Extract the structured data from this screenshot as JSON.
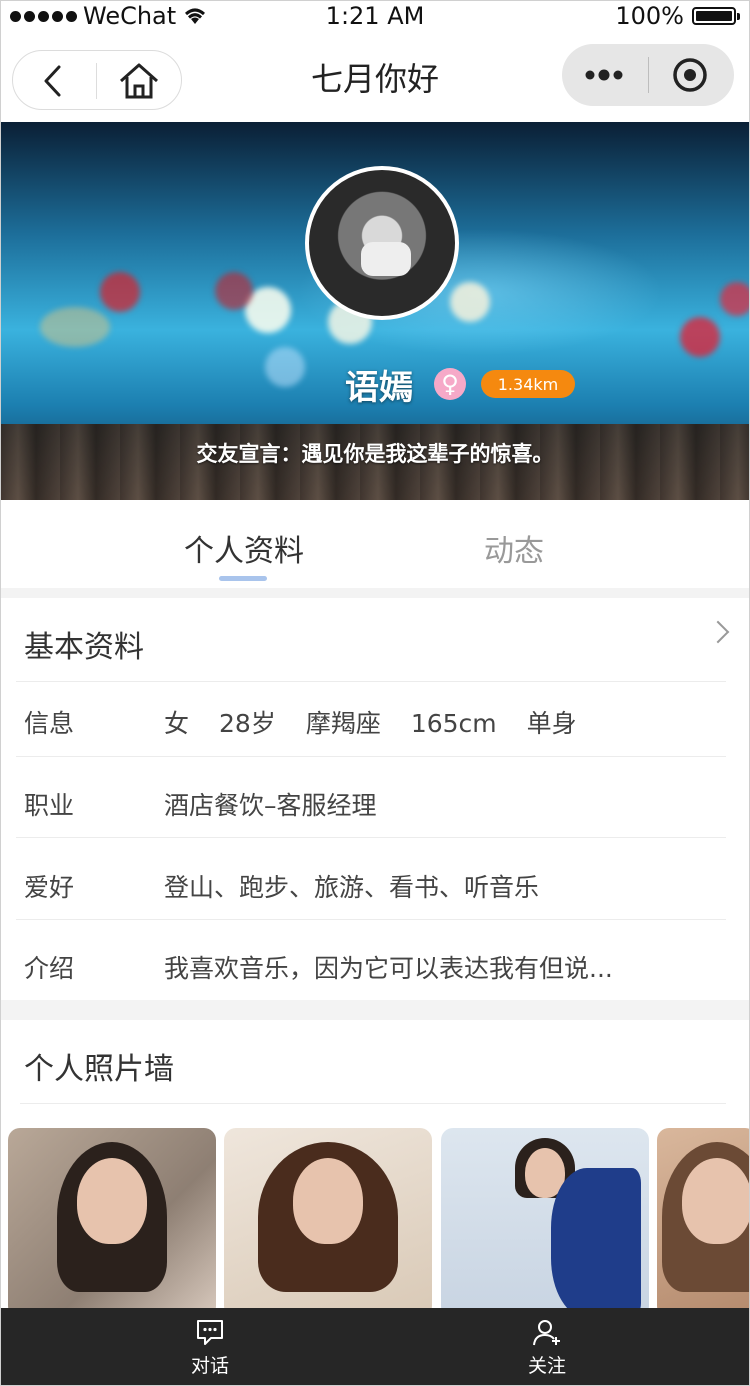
{
  "status_bar": {
    "carrier": "WeChat",
    "time": "1:21 AM",
    "battery": "100%"
  },
  "nav": {
    "title": "七月你好"
  },
  "profile": {
    "name": "语嫣",
    "gender_symbol": "♀",
    "distance": "1.34km",
    "motto": "交友宣言：遇见你是我这辈子的惊喜。"
  },
  "tabs": [
    {
      "label": "个人资料",
      "active": true
    },
    {
      "label": "动态",
      "active": false
    }
  ],
  "basic": {
    "title": "基本资料",
    "rows": [
      {
        "label": "信息",
        "items": [
          "女",
          "28岁",
          "摩羯座",
          "165cm",
          "单身"
        ]
      },
      {
        "label": "职业",
        "value": "酒店餐饮–客服经理"
      },
      {
        "label": "爱好",
        "value": "登山、跑步、旅游、看书、听音乐"
      },
      {
        "label": "介绍",
        "value": "我喜欢音乐，因为它可以表达我有但说..."
      }
    ]
  },
  "photos": {
    "title": "个人照片墙",
    "count_visible": 4
  },
  "bottom_bar": {
    "chat_label": "对话",
    "follow_label": "关注"
  },
  "colors": {
    "distance_badge": "#f5890f",
    "gender_badge": "#f6a9c8",
    "tab_indicator": "#a9c4ec",
    "bottom_bar": "#262626"
  }
}
